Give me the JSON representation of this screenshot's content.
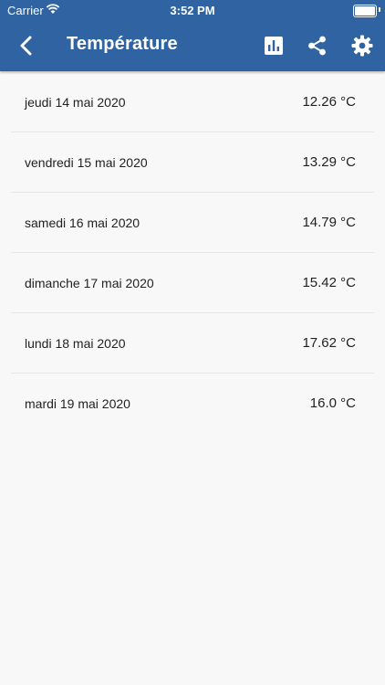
{
  "status_bar": {
    "carrier": "Carrier",
    "time": "3:52 PM"
  },
  "header": {
    "title": "Température",
    "background_color": "#2f63a1",
    "icons": {
      "back": "chevron-left-icon",
      "chart": "bar-chart-icon",
      "share": "share-icon",
      "settings": "gear-icon"
    }
  },
  "readings": [
    {
      "date": "jeudi 14 mai 2020",
      "value": "12.26 °C"
    },
    {
      "date": "vendredi 15 mai 2020",
      "value": "13.29 °C"
    },
    {
      "date": "samedi 16 mai 2020",
      "value": "14.79 °C"
    },
    {
      "date": "dimanche 17 mai 2020",
      "value": "15.42 °C"
    },
    {
      "date": "lundi 18 mai 2020",
      "value": "17.62 °C"
    },
    {
      "date": "mardi 19 mai 2020",
      "value": "16.0 °C"
    }
  ]
}
